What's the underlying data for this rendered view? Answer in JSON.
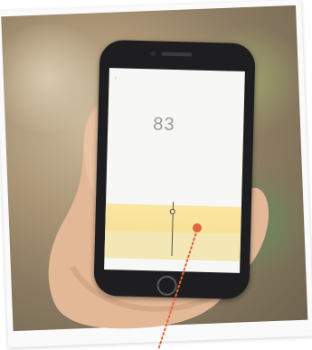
{
  "app": {
    "big_value": "83",
    "back_glyph": "‹",
    "header_title": "",
    "header_sub1": "",
    "header_sub2": "",
    "unit_top": "",
    "unit_bottom": ""
  },
  "chart_axis": [
    "",
    "",
    "",
    "",
    "",
    ""
  ],
  "tabs": [
    "",
    "",
    ""
  ],
  "colors": {
    "accent": "#e6b545",
    "chart_fill": "#f6dd8e",
    "marker": "#e2653d",
    "phone": "#1e1e20"
  },
  "icons": {
    "back": "back-arrow-icon",
    "home": "home-button-icon",
    "marker": "callout-marker-icon"
  }
}
